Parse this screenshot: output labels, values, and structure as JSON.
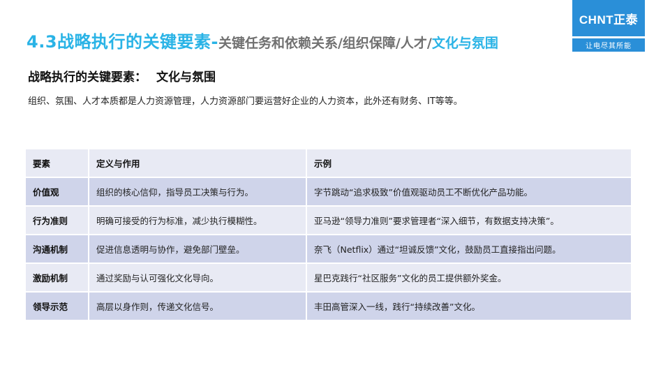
{
  "header": {
    "title_main": "4.3战略执行的关键要素-",
    "title_sub": "关键任务和依赖关系/组织保障/人才/",
    "title_active": "文化与氛围"
  },
  "logo": {
    "brand": "CHNT正泰",
    "tagline": "让电尽其所能"
  },
  "section": {
    "heading": "战略执行的关键要素：",
    "topic": "文化与氛围",
    "intro": "组织、氛围、人才本质都是人力资源管理，人力资源部门要运营好企业的人力资本，此外还有财务、IT等等。"
  },
  "table": {
    "headers": [
      "要素",
      "定义与作用",
      "示例"
    ],
    "rows": [
      {
        "element": "价值观",
        "definition": "组织的核心信仰，指导员工决策与行为。",
        "example": "字节跳动“追求极致”价值观驱动员工不断优化产品功能。"
      },
      {
        "element": "行为准则",
        "definition": "明确可接受的行为标准，减少执行模糊性。",
        "example": "亚马逊“领导力准则”要求管理者“深入细节，有数据支持决策”。"
      },
      {
        "element": "沟通机制",
        "definition": "促进信息透明与协作，避免部门壁垒。",
        "example": "奈飞（Netflix）通过“坦诚反馈”文化，鼓励员工直接指出问题。"
      },
      {
        "element": "激励机制",
        "definition": "通过奖励与认可强化文化导向。",
        "example": "星巴克践行“社区服务”文化的员工提供额外奖金。"
      },
      {
        "element": "领导示范",
        "definition": "高层以身作则，传递文化信号。",
        "example": "丰田高管深入一线，践行“持续改善”文化。"
      }
    ]
  }
}
